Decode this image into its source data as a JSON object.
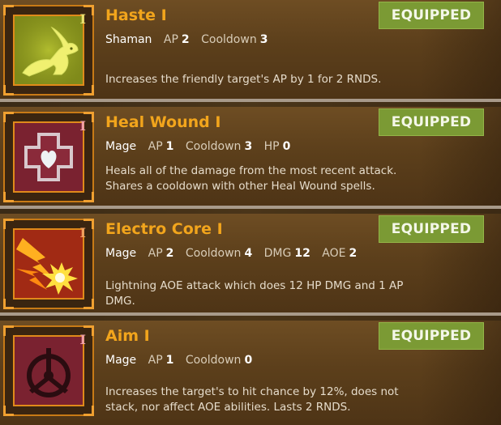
{
  "equipped_label": "EQUIPPED",
  "colors": {
    "title": "#f2a51c",
    "equipped_badge": "#7b9a34",
    "icon_frame": "#e08a1a",
    "card_bg": "#5c3f1b"
  },
  "spells": [
    {
      "name": "Haste I",
      "rank": "I",
      "icon": "rabbit-icon",
      "class": "Shaman",
      "stats": [
        {
          "label": "AP",
          "value": "2"
        },
        {
          "label": "Cooldown",
          "value": "3"
        }
      ],
      "description": "Increases the friendly target's AP by 1 for 2 RNDS."
    },
    {
      "name": "Heal Wound I",
      "rank": "I",
      "icon": "heart-cross-icon",
      "class": "Mage",
      "stats": [
        {
          "label": "AP",
          "value": "1"
        },
        {
          "label": "Cooldown",
          "value": "3"
        },
        {
          "label": "HP",
          "value": "0"
        }
      ],
      "description": "Heals all of the damage from the most recent attack. Shares a cooldown with other Heal Wound spells."
    },
    {
      "name": "Electro Core I",
      "rank": "I",
      "icon": "lightning-burst-icon",
      "class": "Mage",
      "stats": [
        {
          "label": "AP",
          "value": "2"
        },
        {
          "label": "Cooldown",
          "value": "4"
        },
        {
          "label": "DMG",
          "value": "12"
        },
        {
          "label": "AOE",
          "value": "2"
        }
      ],
      "description": "Lightning AOE attack which does 12 HP DMG and 1 AP DMG."
    },
    {
      "name": "Aim I",
      "rank": "I",
      "icon": "crosshair-icon",
      "class": "Mage",
      "stats": [
        {
          "label": "AP",
          "value": "1"
        },
        {
          "label": "Cooldown",
          "value": "0"
        }
      ],
      "description": "Increases the target's to hit chance by 12%, does not stack, nor affect AOE abilities. Lasts 2 RNDS."
    }
  ]
}
